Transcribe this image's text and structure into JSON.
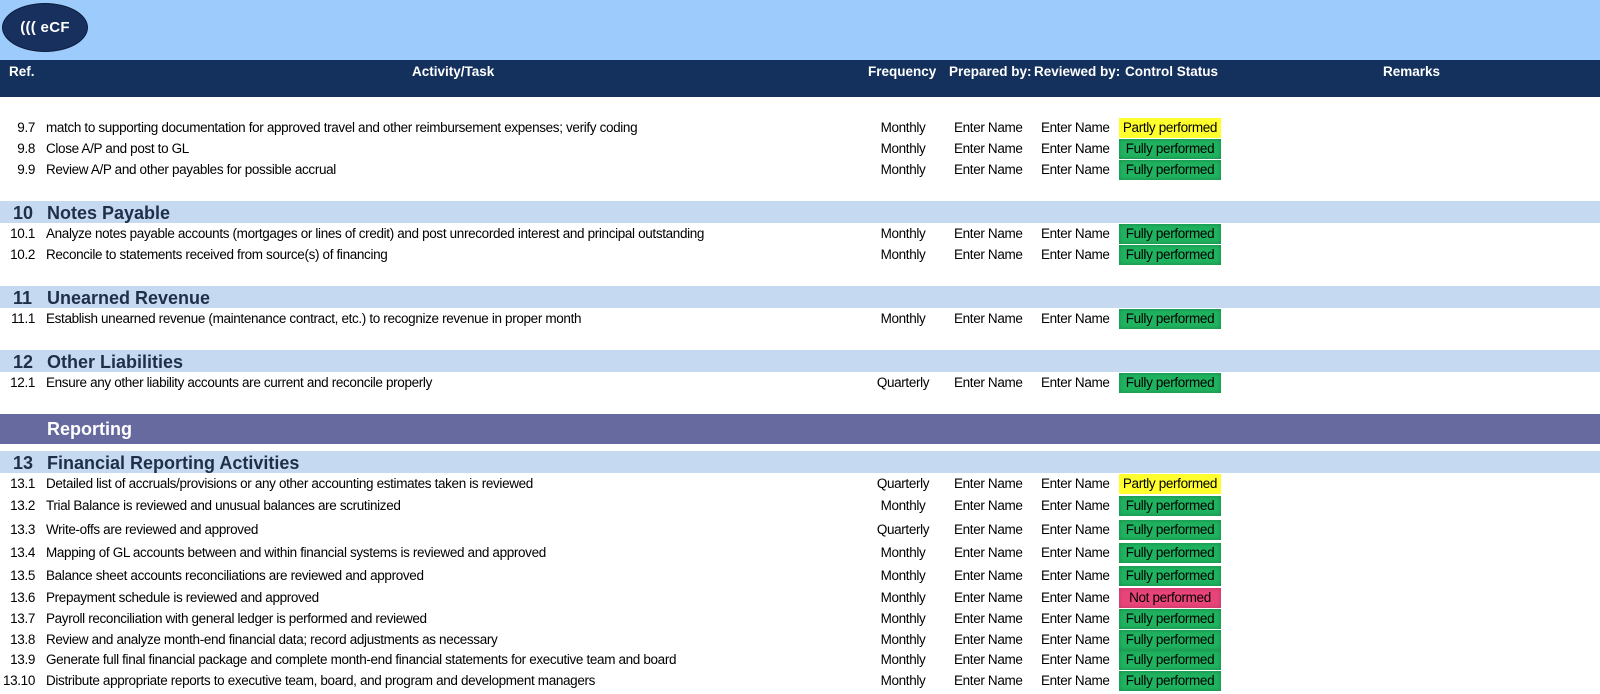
{
  "logo": {
    "text": "((( eCF"
  },
  "header": {
    "ref": "Ref.",
    "task": "Activity/Task",
    "frequency": "Frequency",
    "prepared_by": "Prepared by:",
    "reviewed_by": "Reviewed by:",
    "control_status": "Control Status",
    "remarks": "Remarks"
  },
  "rows_9": [
    {
      "ref": "9.7",
      "task": "match to supporting documentation for approved travel and other reimbursement expenses; verify coding",
      "frequency": "Monthly",
      "prepared": "Enter Name",
      "reviewed": "Enter Name",
      "status": "Partly performed"
    },
    {
      "ref": "9.8",
      "task": "Close A/P and post to GL",
      "frequency": "Monthly",
      "prepared": "Enter Name",
      "reviewed": "Enter Name",
      "status": "Fully performed"
    },
    {
      "ref": "9.9",
      "task": "Review A/P and other payables for possible accrual",
      "frequency": "Monthly",
      "prepared": "Enter Name",
      "reviewed": "Enter Name",
      "status": "Fully performed"
    }
  ],
  "section_10": {
    "num": "10",
    "title": "Notes Payable"
  },
  "rows_10": [
    {
      "ref": "10.1",
      "task": "Analyze notes payable accounts (mortgages or lines of credit) and post unrecorded interest and principal outstanding",
      "frequency": "Monthly",
      "prepared": "Enter Name",
      "reviewed": "Enter Name",
      "status": "Fully performed"
    },
    {
      "ref": "10.2",
      "task": "Reconcile to statements received from source(s) of financing",
      "frequency": "Monthly",
      "prepared": "Enter Name",
      "reviewed": "Enter Name",
      "status": "Fully performed"
    }
  ],
  "section_11": {
    "num": "11",
    "title": "Unearned Revenue"
  },
  "rows_11": [
    {
      "ref": "11.1",
      "task": "Establish unearned revenue (maintenance contract, etc.) to recognize revenue in proper month",
      "frequency": "Monthly",
      "prepared": "Enter Name",
      "reviewed": "Enter Name",
      "status": "Fully performed"
    }
  ],
  "section_12": {
    "num": "12",
    "title": "Other Liabilities"
  },
  "rows_12": [
    {
      "ref": "12.1",
      "task": "Ensure any other liability accounts are current and reconcile properly",
      "frequency": "Quarterly",
      "prepared": "Enter Name",
      "reviewed": "Enter Name",
      "status": "Fully performed"
    }
  ],
  "band": {
    "title": "Reporting"
  },
  "section_13": {
    "num": "13",
    "title": "Financial Reporting Activities"
  },
  "rows_13": [
    {
      "ref": "13.1",
      "task": "Detailed list of  accruals/provisions or any other accounting estimates taken is reviewed",
      "frequency": "Quarterly",
      "prepared": "Enter Name",
      "reviewed": "Enter Name",
      "status": "Partly performed"
    },
    {
      "ref": "13.2",
      "task": "Trial Balance is reviewed and unusual balances are scrutinized",
      "frequency": "Monthly",
      "prepared": "Enter Name",
      "reviewed": "Enter Name",
      "status": "Fully performed"
    },
    {
      "ref": "13.3",
      "task": "Write-offs are reviewed and approved",
      "frequency": "Quarterly",
      "prepared": "Enter Name",
      "reviewed": "Enter Name",
      "status": "Fully performed"
    },
    {
      "ref": "13.4",
      "task": "Mapping of GL accounts between and within financial systems is reviewed and approved",
      "frequency": "Monthly",
      "prepared": "Enter Name",
      "reviewed": "Enter Name",
      "status": "Fully performed"
    },
    {
      "ref": "13.5",
      "task": "Balance sheet accounts reconciliations are reviewed and approved",
      "frequency": "Monthly",
      "prepared": "Enter Name",
      "reviewed": "Enter Name",
      "status": "Fully performed"
    },
    {
      "ref": "13.6",
      "task": "Prepayment schedule is reviewed and approved",
      "frequency": "Monthly",
      "prepared": "Enter Name",
      "reviewed": "Enter Name",
      "status": "Not performed"
    },
    {
      "ref": "13.7",
      "task": "Payroll reconciliation with general ledger is performed and reviewed",
      "frequency": "Monthly",
      "prepared": "Enter Name",
      "reviewed": "Enter Name",
      "status": "Fully performed"
    },
    {
      "ref": "13.8",
      "task": "Review and analyze month-end financial data; record adjustments as necessary",
      "frequency": "Monthly",
      "prepared": "Enter Name",
      "reviewed": "Enter Name",
      "status": "Fully performed"
    },
    {
      "ref": "13.9",
      "task": "Generate full final financial package and complete month-end financial statements for executive team and board",
      "frequency": "Monthly",
      "prepared": "Enter Name",
      "reviewed": "Enter Name",
      "status": "Fully performed"
    },
    {
      "ref": "13.10",
      "task": "Distribute appropriate reports to executive team, board, and program and development managers",
      "frequency": "Monthly",
      "prepared": "Enter Name",
      "reviewed": "Enter Name",
      "status": "Fully performed"
    }
  ],
  "status_colors": {
    "Fully performed": "#1fb35f",
    "Partly performed": "#ffff2e",
    "Not performed": "#e8447a"
  }
}
